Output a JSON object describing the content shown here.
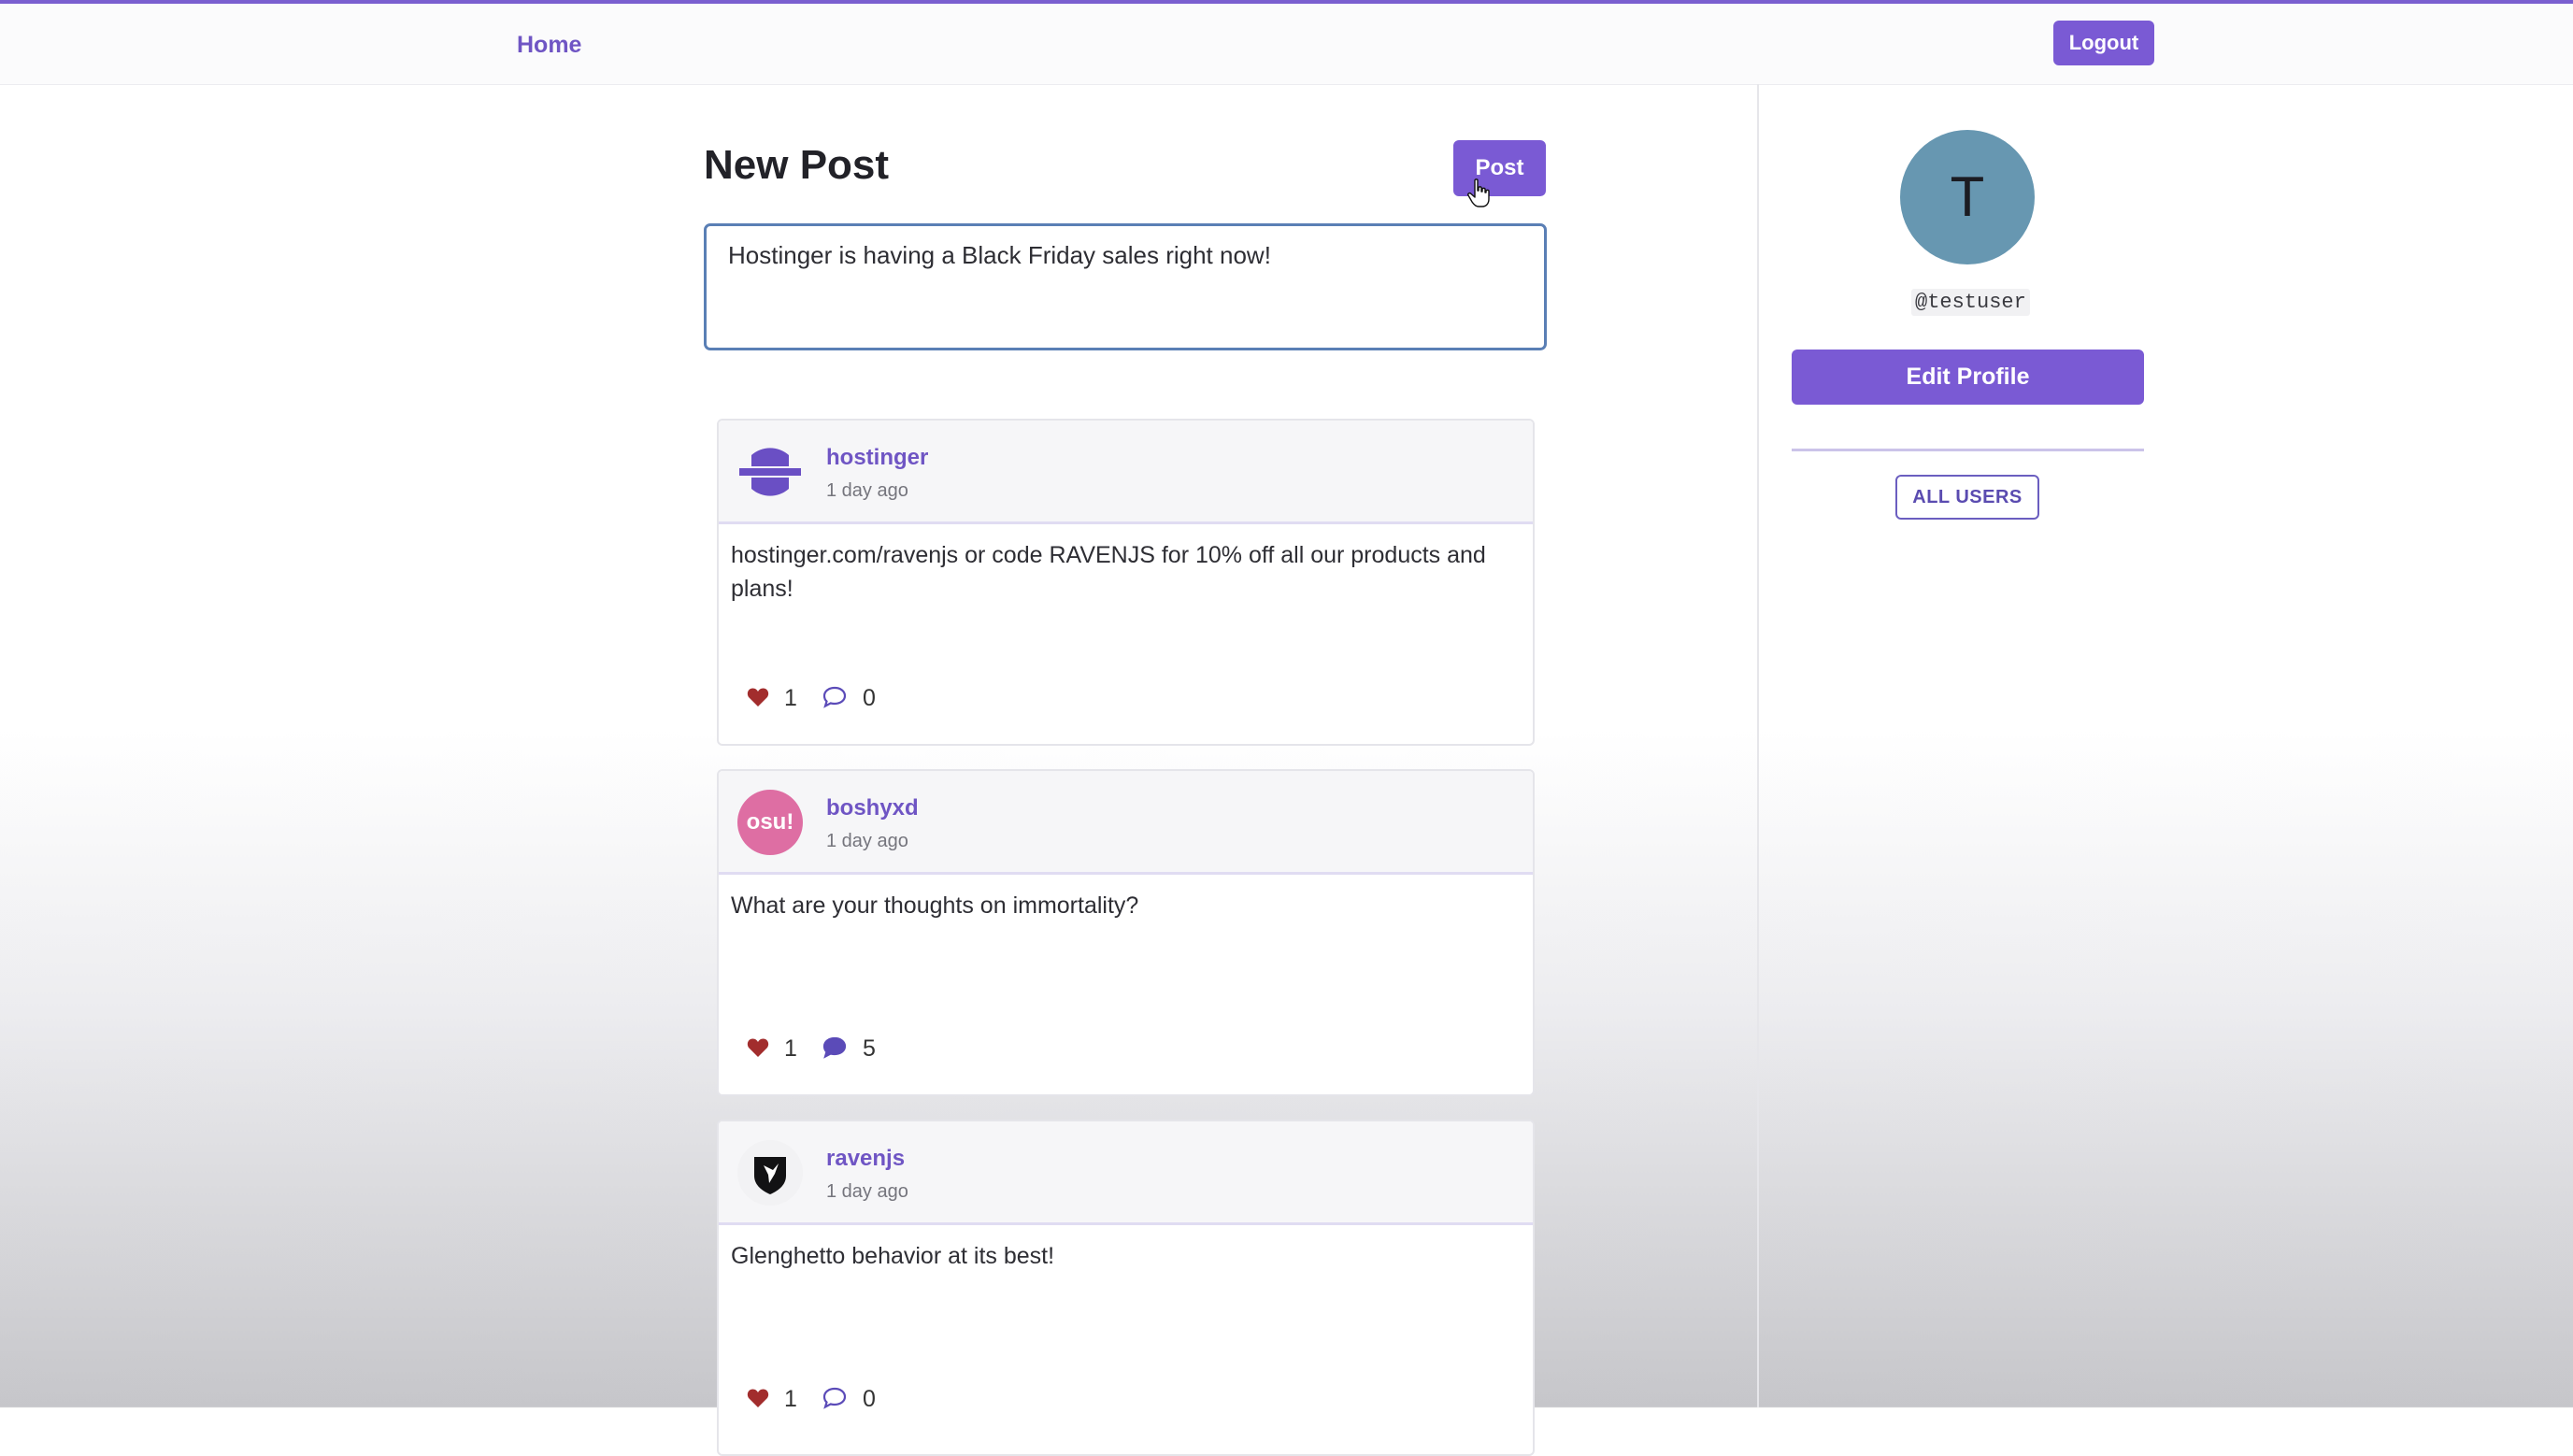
{
  "nav": {
    "home_label": "Home",
    "logout_label": "Logout"
  },
  "composer": {
    "title": "New Post",
    "post_button": "Post",
    "input_value": "Hostinger is having a Black Friday sales right now!"
  },
  "feed": {
    "posts": [
      {
        "author": "hostinger",
        "time": "1 day ago",
        "avatar_icon": "hostinger-logo-icon",
        "body": "hostinger.com/ravenjs or code RAVENJS for 10% off all our products and plans!",
        "likes": "1",
        "comments": "0",
        "comment_icon_filled": false
      },
      {
        "author": "boshyxd",
        "time": "1 day ago",
        "avatar_icon": "osu-logo-icon",
        "avatar_text": "osu!",
        "body": "What are your thoughts on immortality?",
        "likes": "1",
        "comments": "5",
        "comment_icon_filled": true
      },
      {
        "author": "ravenjs",
        "time": "1 day ago",
        "avatar_icon": "raven-shield-icon",
        "body": "Glenghetto behavior at its best!",
        "likes": "1",
        "comments": "0",
        "comment_icon_filled": false
      }
    ]
  },
  "profile": {
    "avatar_letter": "T",
    "handle": "@testuser",
    "edit_label": "Edit Profile",
    "all_users_label": "ALL USERS"
  },
  "colors": {
    "accent": "#7a5ad4",
    "link": "#6f55c4",
    "heart": "#a22d2d",
    "profile_avatar": "#6797b1",
    "osu_pink": "#de6ea3"
  }
}
